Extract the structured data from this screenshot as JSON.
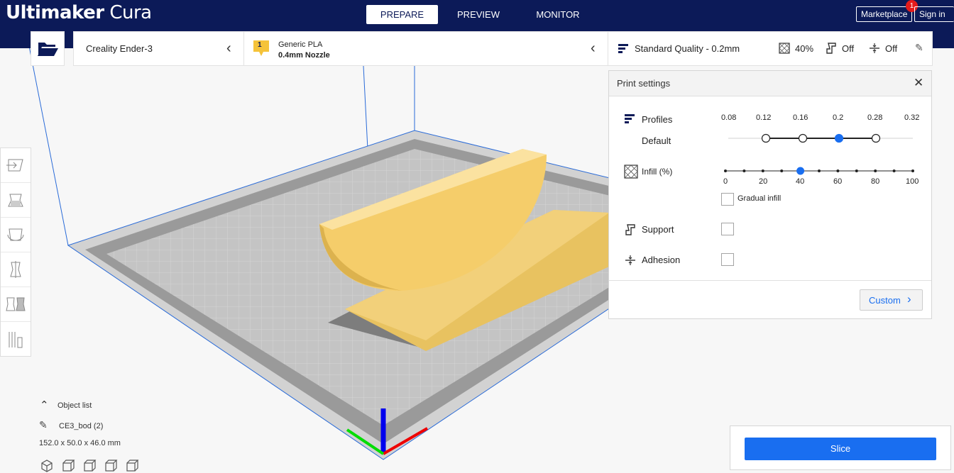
{
  "app": {
    "logo_bold": "Ultimaker",
    "logo_light": "Cura"
  },
  "stages": {
    "prepare": "PREPARE",
    "preview": "PREVIEW",
    "monitor": "MONITOR"
  },
  "header_buttons": {
    "marketplace": "Marketplace",
    "marketplace_badge": "1",
    "sign_in": "Sign in"
  },
  "printer": {
    "name": "Creality Ender-3"
  },
  "material": {
    "badge": "1",
    "name": "Generic PLA",
    "nozzle": "0.4mm Nozzle"
  },
  "quality": {
    "profile": "Standard Quality - 0.2mm",
    "infill": "40%",
    "support": "Off",
    "adhesion": "Off"
  },
  "print_settings": {
    "title": "Print settings",
    "profiles_label": "Profiles",
    "default_label": "Default",
    "layer_heights": [
      "0.08",
      "0.12",
      "0.16",
      "0.2",
      "0.28",
      "0.32"
    ],
    "selected_layer_height": "0.2",
    "infill_label": "Infill (%)",
    "infill_ticks": [
      "0",
      "20",
      "40",
      "60",
      "80",
      "100"
    ],
    "infill_value": 40,
    "gradual_infill_label": "Gradual infill",
    "support_label": "Support",
    "adhesion_label": "Adhesion",
    "custom_button": "Custom"
  },
  "object_list": {
    "header": "Object list",
    "object_name": "CE3_bod (2)",
    "dimensions": "152.0 x 50.0 x 46.0 mm"
  },
  "slice": {
    "button": "Slice"
  },
  "colors": {
    "header_bg": "#0c1a58",
    "accent": "#196ef0",
    "model": "#f5cd6a",
    "badge": "#e51b1b"
  }
}
